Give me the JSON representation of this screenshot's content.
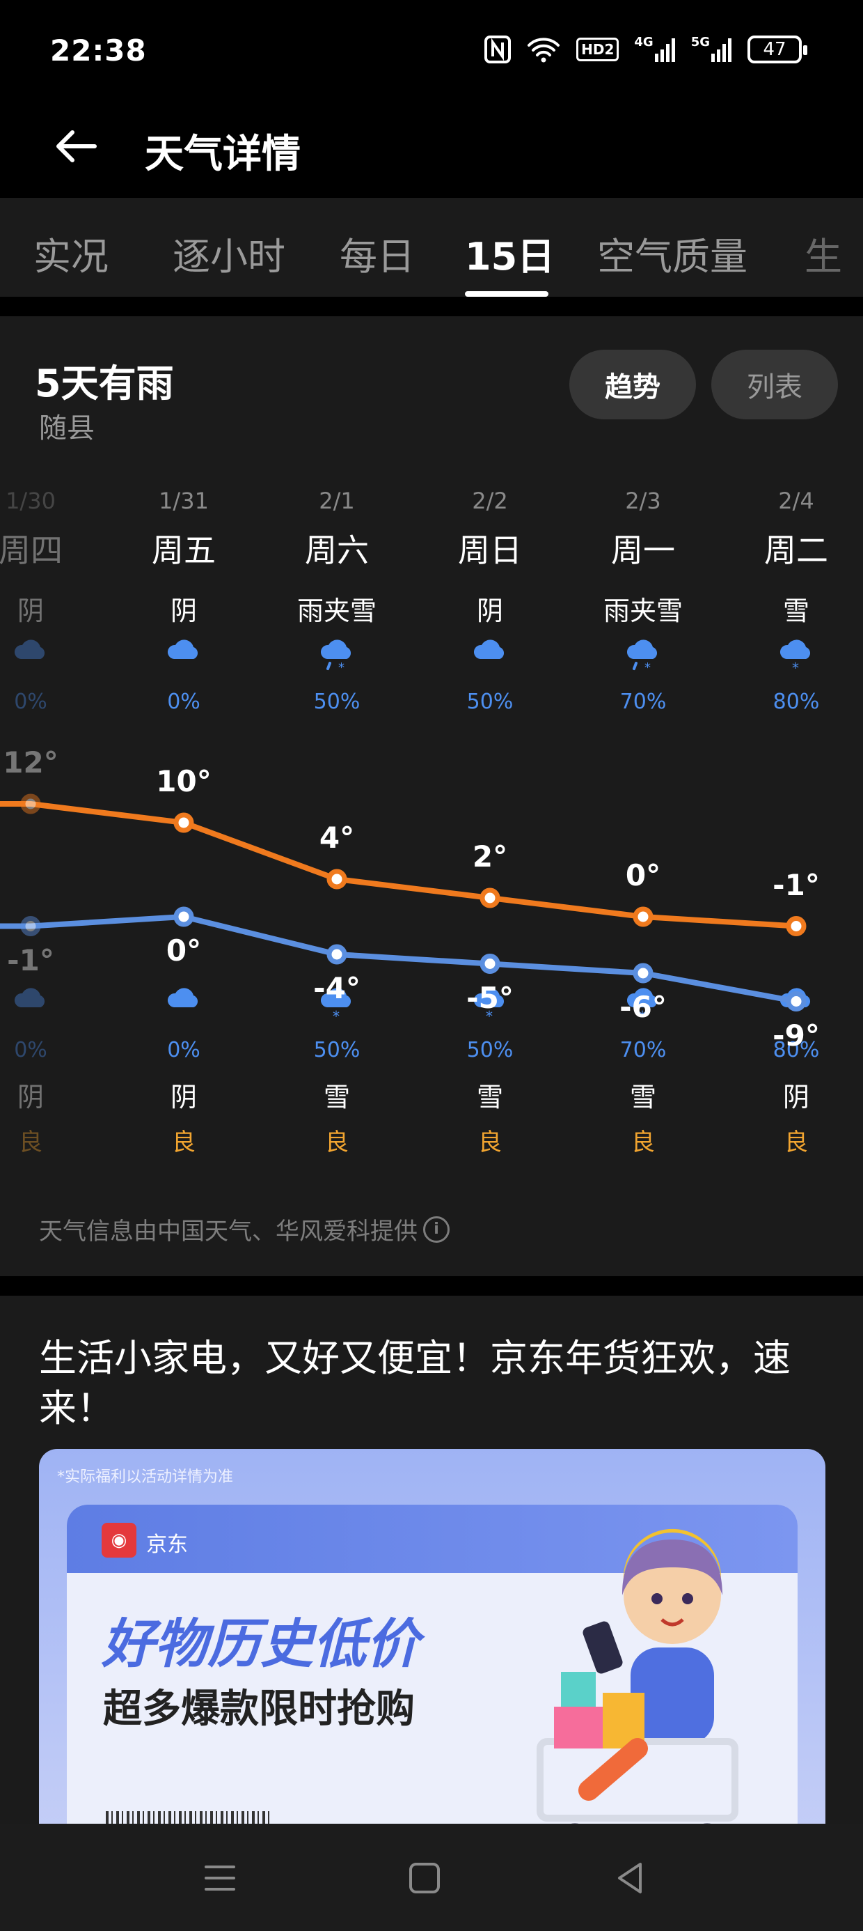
{
  "status_bar": {
    "time": "22:38",
    "battery": "47",
    "hd_label": "HD2",
    "net1": "4G",
    "net2": "5G"
  },
  "header": {
    "title": "天气详情"
  },
  "tabs": [
    {
      "label": "实况",
      "active": false
    },
    {
      "label": "逐小时",
      "active": false
    },
    {
      "label": "每日",
      "active": false
    },
    {
      "label": "15日",
      "active": true
    },
    {
      "label": "空气质量",
      "active": false
    },
    {
      "label": "生",
      "active": false
    }
  ],
  "forecast": {
    "title": "5天有雨",
    "location": "随县",
    "toggle": {
      "trend": "趋势",
      "list": "列表"
    },
    "days": [
      {
        "date": "1/30",
        "weekday": "周四",
        "day_cond": "阴",
        "day_precip": "0%",
        "high": "12°",
        "low": "-1°",
        "night_precip": "0%",
        "night_cond": "阴",
        "aqi": "良"
      },
      {
        "date": "1/31",
        "weekday": "周五",
        "day_cond": "阴",
        "day_precip": "0%",
        "high": "10°",
        "low": "0°",
        "night_precip": "0%",
        "night_cond": "阴",
        "aqi": "良"
      },
      {
        "date": "2/1",
        "weekday": "周六",
        "day_cond": "雨夹雪",
        "day_precip": "50%",
        "high": "4°",
        "low": "-4°",
        "night_precip": "50%",
        "night_cond": "雪",
        "aqi": "良"
      },
      {
        "date": "2/2",
        "weekday": "周日",
        "day_cond": "阴",
        "day_precip": "50%",
        "high": "2°",
        "low": "-5°",
        "night_precip": "50%",
        "night_cond": "雪",
        "aqi": "良"
      },
      {
        "date": "2/3",
        "weekday": "周一",
        "day_cond": "雨夹雪",
        "day_precip": "70%",
        "high": "0°",
        "low": "-6°",
        "night_precip": "70%",
        "night_cond": "雪",
        "aqi": "良"
      },
      {
        "date": "2/4",
        "weekday": "周二",
        "day_cond": "雪",
        "day_precip": "80%",
        "high": "-1°",
        "low": "-9°",
        "night_precip": "80%",
        "night_cond": "阴",
        "aqi": "良"
      }
    ],
    "high_values": [
      12,
      10,
      4,
      2,
      0,
      -1
    ],
    "low_values": [
      -1,
      0,
      -4,
      -5,
      -6,
      -9
    ],
    "provider": "天气信息由中国天气、华风爱科提供"
  },
  "colors": {
    "high_line": "#f07a1e",
    "low_line": "#5b8fe0",
    "accent_blue": "#4d8ff0",
    "aqi_good": "#f2a530"
  },
  "ad": {
    "title": "生活小家电，又好又便宜！京东年货狂欢，速来！",
    "note": "*实际福利以活动详情为准",
    "brand": "京东",
    "headline": "好物历史低价",
    "subline": "超多爆款限时抢购"
  }
}
